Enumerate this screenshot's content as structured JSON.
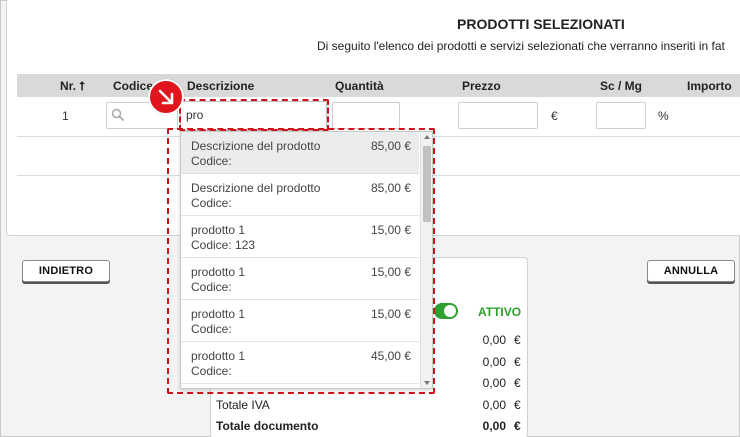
{
  "panel": {
    "title": "PRODOTTI SELEZIONATI",
    "subtitle": "Di seguito l'elenco dei prodotti e servizi selezionati che verranno inseriti in fat"
  },
  "table": {
    "headers": {
      "number": "Nr. ⭡",
      "code": "Codice",
      "description": "Descrizione",
      "quantity": "Quantità",
      "price": "Prezzo",
      "discount": "Sc / Mg",
      "amount": "Importo"
    },
    "row": {
      "number": "1",
      "description_value": "pro",
      "currency": "€",
      "percent": "%"
    }
  },
  "badge": {
    "icon": "arrow-down-right-icon",
    "color": "#e0151d"
  },
  "dropdown": {
    "items": [
      {
        "name": "Descrizione del prodotto",
        "code": "Codice:",
        "price": "85,00 €"
      },
      {
        "name": "Descrizione del prodotto",
        "code": "Codice:",
        "price": "85,00 €"
      },
      {
        "name": "prodotto 1",
        "code": "Codice: 123",
        "price": "15,00 €"
      },
      {
        "name": "prodotto 1",
        "code": "Codice:",
        "price": "15,00 €"
      },
      {
        "name": "prodotto 1",
        "code": "Codice:",
        "price": "15,00 €"
      },
      {
        "name": "prodotto 1",
        "code": "Codice:",
        "price": "45,00 €"
      }
    ]
  },
  "buttons": {
    "back": "INDIETRO",
    "cancel": "ANNULLA"
  },
  "summary": {
    "status": "ATTIVO",
    "status_color": "#2fa02f",
    "values": [
      {
        "value": "0,00",
        "currency": "€"
      },
      {
        "value": "0,00",
        "currency": "€"
      },
      {
        "value": "0,00",
        "currency": "€"
      }
    ],
    "iva_label": "Totale IVA",
    "iva_value": "0,00",
    "iva_currency": "€",
    "total_label": "Totale documento",
    "total_value": "0,00",
    "total_currency": "€"
  }
}
